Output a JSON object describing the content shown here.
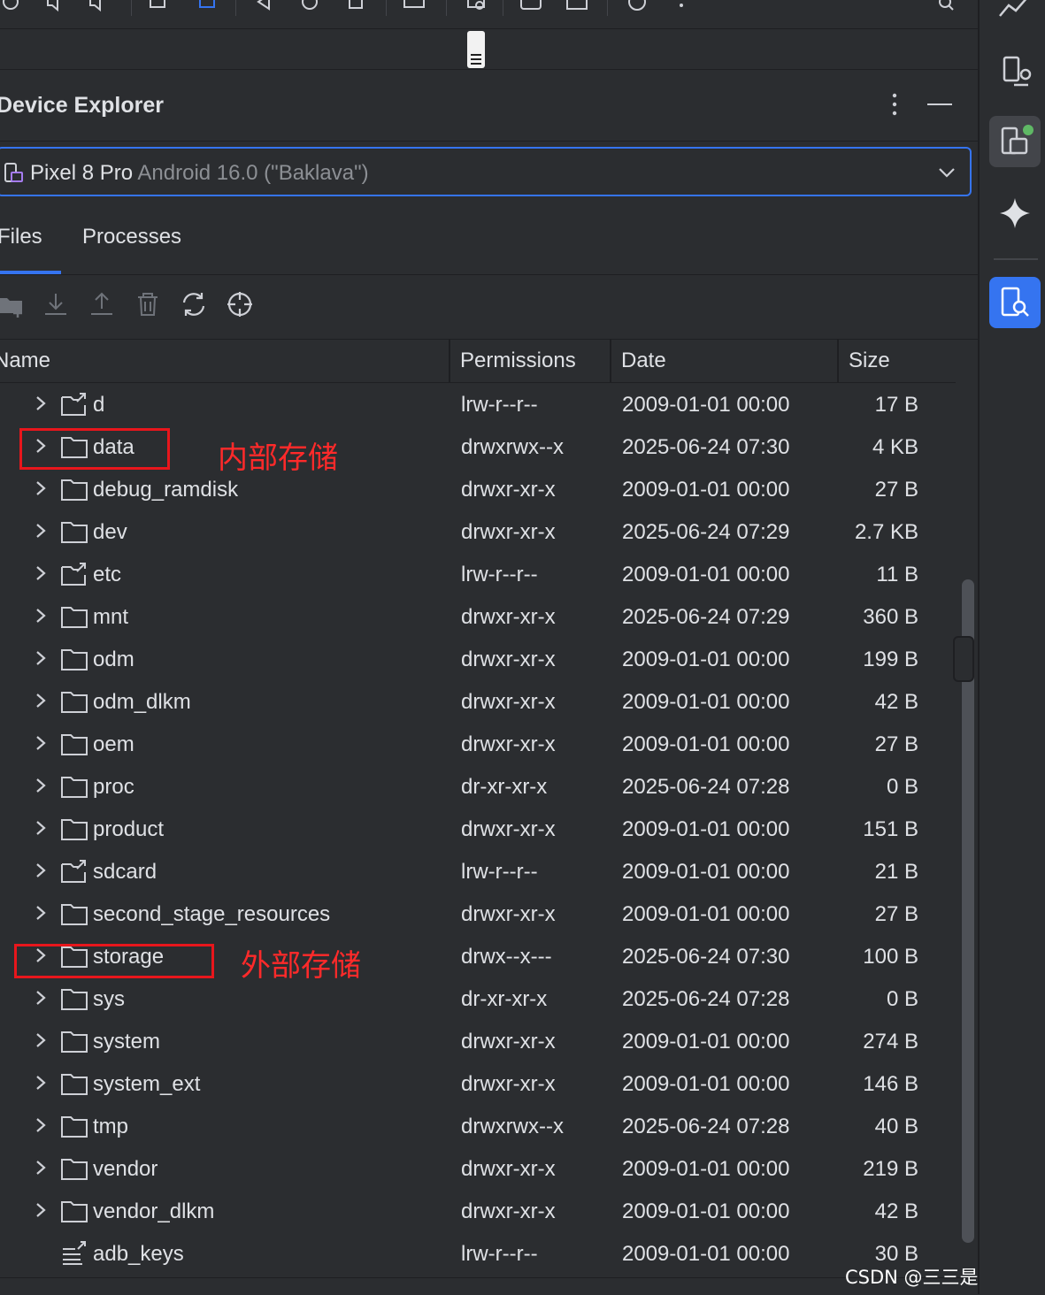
{
  "panel": {
    "title": "Device Explorer"
  },
  "device": {
    "name": "Pixel 8 Pro",
    "version": "Android 16.0 (\"Baklava\")"
  },
  "tabs": [
    {
      "label": "Files",
      "active": true
    },
    {
      "label": "Processes",
      "active": false
    }
  ],
  "table": {
    "columns": [
      "Name",
      "Permissions",
      "Date",
      "Size"
    ],
    "rows": [
      {
        "name": "d",
        "type": "link",
        "permissions": "lrw-r--r--",
        "date": "2009-01-01 00:00",
        "size": "17 B"
      },
      {
        "name": "data",
        "type": "folder",
        "permissions": "drwxrwx--x",
        "date": "2025-06-24 07:30",
        "size": "4 KB"
      },
      {
        "name": "debug_ramdisk",
        "type": "folder",
        "permissions": "drwxr-xr-x",
        "date": "2009-01-01 00:00",
        "size": "27 B"
      },
      {
        "name": "dev",
        "type": "folder",
        "permissions": "drwxr-xr-x",
        "date": "2025-06-24 07:29",
        "size": "2.7 KB"
      },
      {
        "name": "etc",
        "type": "link",
        "permissions": "lrw-r--r--",
        "date": "2009-01-01 00:00",
        "size": "11 B"
      },
      {
        "name": "mnt",
        "type": "folder",
        "permissions": "drwxr-xr-x",
        "date": "2025-06-24 07:29",
        "size": "360 B"
      },
      {
        "name": "odm",
        "type": "folder",
        "permissions": "drwxr-xr-x",
        "date": "2009-01-01 00:00",
        "size": "199 B"
      },
      {
        "name": "odm_dlkm",
        "type": "folder",
        "permissions": "drwxr-xr-x",
        "date": "2009-01-01 00:00",
        "size": "42 B"
      },
      {
        "name": "oem",
        "type": "folder",
        "permissions": "drwxr-xr-x",
        "date": "2009-01-01 00:00",
        "size": "27 B"
      },
      {
        "name": "proc",
        "type": "folder",
        "permissions": "dr-xr-xr-x",
        "date": "2025-06-24 07:28",
        "size": "0 B"
      },
      {
        "name": "product",
        "type": "folder",
        "permissions": "drwxr-xr-x",
        "date": "2009-01-01 00:00",
        "size": "151 B"
      },
      {
        "name": "sdcard",
        "type": "link",
        "permissions": "lrw-r--r--",
        "date": "2009-01-01 00:00",
        "size": "21 B"
      },
      {
        "name": "second_stage_resources",
        "type": "folder",
        "permissions": "drwxr-xr-x",
        "date": "2009-01-01 00:00",
        "size": "27 B"
      },
      {
        "name": "storage",
        "type": "folder",
        "permissions": "drwx--x---",
        "date": "2025-06-24 07:30",
        "size": "100 B"
      },
      {
        "name": "sys",
        "type": "folder",
        "permissions": "dr-xr-xr-x",
        "date": "2025-06-24 07:28",
        "size": "0 B"
      },
      {
        "name": "system",
        "type": "folder",
        "permissions": "drwxr-xr-x",
        "date": "2009-01-01 00:00",
        "size": "274 B"
      },
      {
        "name": "system_ext",
        "type": "folder",
        "permissions": "drwxr-xr-x",
        "date": "2009-01-01 00:00",
        "size": "146 B"
      },
      {
        "name": "tmp",
        "type": "folder",
        "permissions": "drwxrwx--x",
        "date": "2025-06-24 07:28",
        "size": "40 B"
      },
      {
        "name": "vendor",
        "type": "folder",
        "permissions": "drwxr-xr-x",
        "date": "2009-01-01 00:00",
        "size": "219 B"
      },
      {
        "name": "vendor_dlkm",
        "type": "folder",
        "permissions": "drwxr-xr-x",
        "date": "2009-01-01 00:00",
        "size": "42 B"
      },
      {
        "name": "adb_keys",
        "type": "file",
        "permissions": "lrw-r--r--",
        "date": "2009-01-01 00:00",
        "size": "30 B"
      }
    ]
  },
  "annotations": {
    "internal_storage": "内部存储",
    "external_storage": "外部存储"
  },
  "watermark": "CSDN @三三是该溜子",
  "colors": {
    "accent": "#3574f0",
    "highlight": "#e8161c",
    "background": "#2b2d30",
    "text": "#dfe1e5"
  }
}
